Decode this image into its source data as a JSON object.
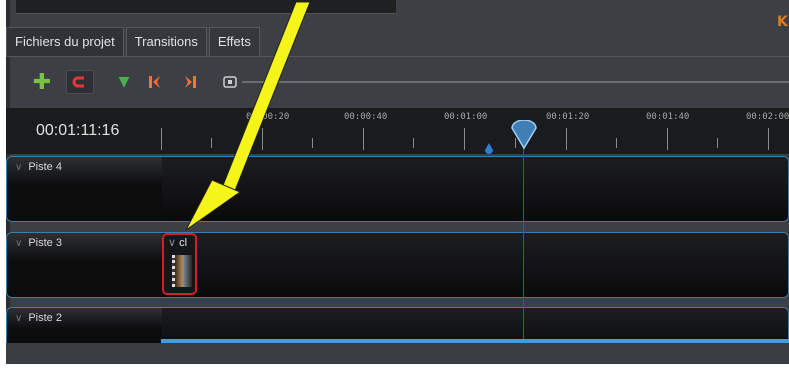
{
  "app": {
    "brand_letter": "K",
    "grip": "......"
  },
  "tabs": [
    {
      "label": "Fichiers du projet"
    },
    {
      "label": "Transitions"
    },
    {
      "label": "Effets"
    }
  ],
  "toolbar": {
    "icons": [
      "add-track-icon",
      "magnet-snap-icon",
      "add-marker-icon",
      "previous-marker-icon",
      "next-marker-icon",
      "center-playhead-icon"
    ],
    "zoom_level": 0.04
  },
  "timeline": {
    "timecode": "00:01:11:16",
    "ruler_labels": [
      "00:00:20",
      "00:00:40",
      "00:01:00",
      "00:01:20",
      "00:01:40",
      "00:02:00"
    ],
    "tracks": [
      {
        "name": "Piste 4",
        "has_clip": false
      },
      {
        "name": "Piste 3",
        "has_clip": true,
        "clip_title": "cl"
      },
      {
        "name": "Piste 2",
        "has_clip": false
      }
    ]
  },
  "colors": {
    "accent": "#4a9bd4",
    "playhead": "#c8202a",
    "clip_border": "#d31f2a",
    "annotation_arrow": "#f5f51a"
  }
}
